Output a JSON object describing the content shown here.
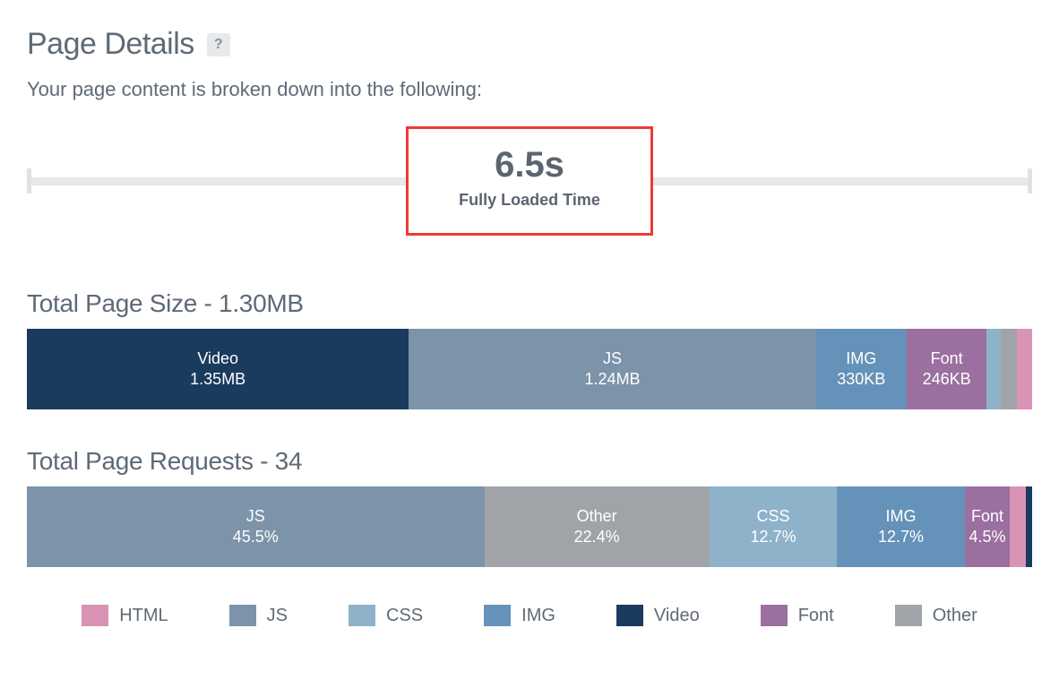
{
  "title": "Page Details",
  "help_glyph": "?",
  "subtitle": "Your page content is broken down into the following:",
  "timeline": {
    "value": "6.5s",
    "label": "Fully Loaded Time"
  },
  "size_section": {
    "heading": "Total Page Size - 1.30MB"
  },
  "requests_section": {
    "heading": "Total Page Requests -  34"
  },
  "legend": {
    "html": "HTML",
    "js": "JS",
    "css": "CSS",
    "img": "IMG",
    "video": "Video",
    "font": "Font",
    "other": "Other"
  },
  "chart_data": [
    {
      "type": "bar",
      "title": "Total Page Size - 1.30MB",
      "stacked": true,
      "orientation": "horizontal",
      "series": [
        {
          "name": "Video",
          "label": "Video",
          "value_label": "1.35MB",
          "weight": 38.0,
          "color": "#1a3a5e"
        },
        {
          "name": "JS",
          "label": "JS",
          "value_label": "1.24MB",
          "weight": 40.5,
          "color": "#7c93aa"
        },
        {
          "name": "IMG",
          "label": "IMG",
          "value_label": "330KB",
          "weight": 9.0,
          "color": "#6592b8"
        },
        {
          "name": "Font",
          "label": "Font",
          "value_label": "246KB",
          "weight": 8.0,
          "color": "#9b6fa0"
        },
        {
          "name": "CSS",
          "label": "",
          "value_label": "",
          "weight": 1.4,
          "color": "#8fb2cb"
        },
        {
          "name": "Other",
          "label": "",
          "value_label": "",
          "weight": 1.6,
          "color": "#a0a4a9"
        },
        {
          "name": "HTML",
          "label": "",
          "value_label": "",
          "weight": 1.5,
          "color": "#d893b5"
        }
      ]
    },
    {
      "type": "bar",
      "title": "Total Page Requests - 34",
      "stacked": true,
      "orientation": "horizontal",
      "series": [
        {
          "name": "JS",
          "label": "JS",
          "value_label": "45.5%",
          "weight": 45.5,
          "color": "#7c93aa"
        },
        {
          "name": "Other",
          "label": "Other",
          "value_label": "22.4%",
          "weight": 22.4,
          "color": "#a0a4a9"
        },
        {
          "name": "CSS",
          "label": "CSS",
          "value_label": "12.7%",
          "weight": 12.7,
          "color": "#8fb2cb"
        },
        {
          "name": "IMG",
          "label": "IMG",
          "value_label": "12.7%",
          "weight": 12.7,
          "color": "#6592b8"
        },
        {
          "name": "Font",
          "label": "Font",
          "value_label": "4.5%",
          "weight": 4.5,
          "color": "#9b6fa0"
        },
        {
          "name": "HTML",
          "label": "",
          "value_label": "",
          "weight": 1.6,
          "color": "#d893b5"
        },
        {
          "name": "Video",
          "label": "",
          "value_label": "",
          "weight": 0.6,
          "color": "#1a3a5e"
        }
      ]
    }
  ]
}
